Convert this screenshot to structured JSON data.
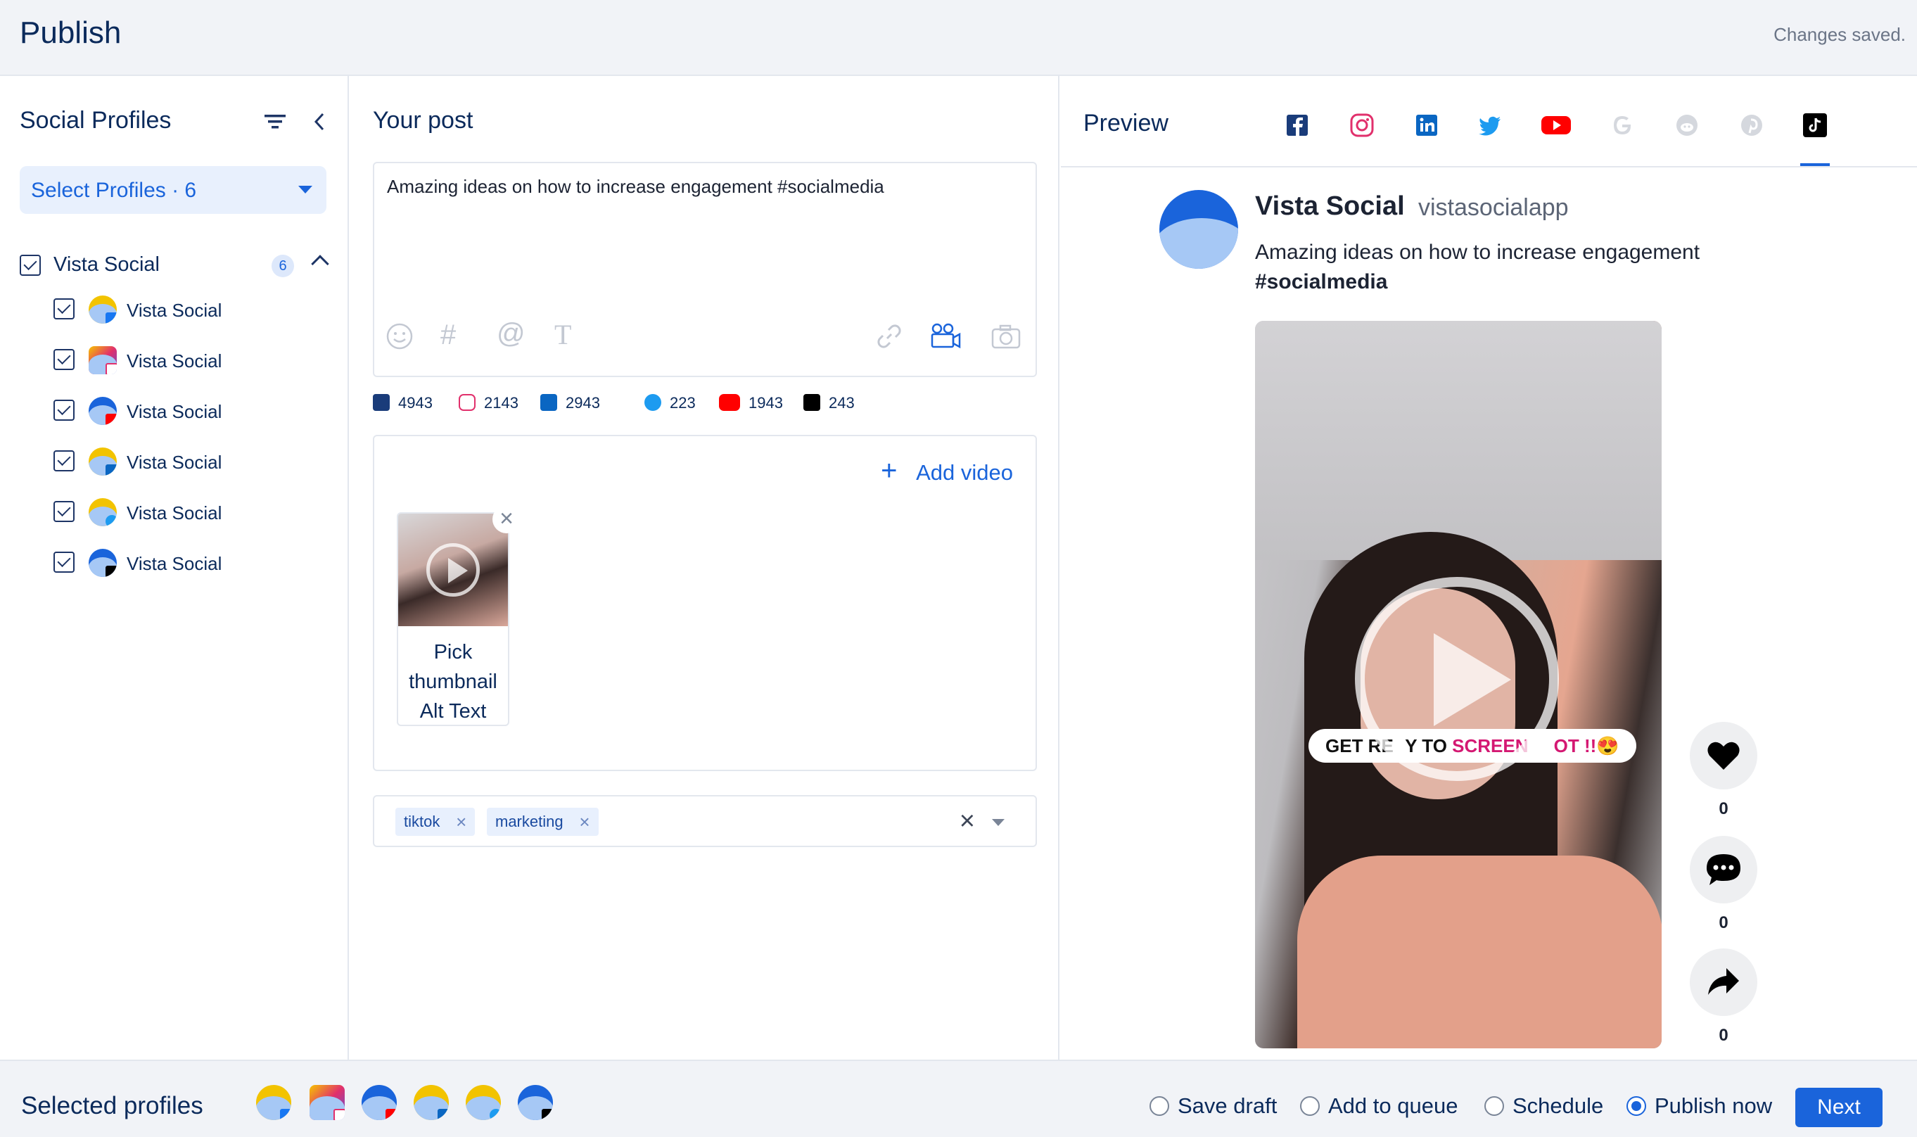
{
  "header": {
    "title": "Publish",
    "status": "Changes saved."
  },
  "profiles_panel": {
    "title": "Social Profiles",
    "select_label": "Select Profiles · 6",
    "group": {
      "name": "Vista Social",
      "count": "6"
    },
    "items": [
      {
        "name": "Vista Social",
        "network": "facebook"
      },
      {
        "name": "Vista Social",
        "network": "instagram"
      },
      {
        "name": "Vista Social",
        "network": "youtube"
      },
      {
        "name": "Vista Social",
        "network": "linkedin"
      },
      {
        "name": "Vista Social",
        "network": "twitter"
      },
      {
        "name": "Vista Social",
        "network": "tiktok"
      }
    ]
  },
  "post_panel": {
    "title": "Your post",
    "text": "Amazing ideas on how to increase engagement #socialmedia",
    "tools": {
      "hashtag": "#",
      "mention": "@",
      "text_format": "T"
    },
    "char_counts": [
      {
        "network": "facebook",
        "value": "4943",
        "color": "#1877f2"
      },
      {
        "network": "instagram",
        "value": "2143",
        "color": "#e1306c"
      },
      {
        "network": "linkedin",
        "value": "2943",
        "color": "#0a66c2"
      },
      {
        "network": "twitter",
        "value": "223",
        "color": "#1d9bf0"
      },
      {
        "network": "youtube",
        "value": "1943",
        "color": "#ff0000"
      },
      {
        "network": "tiktok",
        "value": "243",
        "color": "#000000"
      }
    ],
    "add_video_label": "Add video",
    "thumbnail": {
      "close": "×",
      "label_line1": "Pick",
      "label_line2": "thumbnail",
      "label_line3": "Alt Text"
    },
    "tags": [
      {
        "label": "tiktok"
      },
      {
        "label": "marketing"
      }
    ],
    "tag_remove": "×",
    "tags_clear": "×"
  },
  "preview_panel": {
    "title": "Preview",
    "networks": [
      "facebook",
      "instagram",
      "linkedin",
      "twitter",
      "youtube",
      "google",
      "reddit",
      "pinterest",
      "tiktok"
    ],
    "active_network": "tiktok",
    "profile_name": "Vista Social",
    "handle": "vistasocialapp",
    "text_line1": "Amazing ideas on how to increase engagement",
    "text_hashtag": "#socialmedia",
    "video_caption_a": "GET RE",
    "video_caption_b": "Y TO ",
    "video_caption_c": "SCREEN",
    "video_caption_d": "OT !!",
    "video_caption_emoji": "😍",
    "likes": "0",
    "comments": "0",
    "shares": "0"
  },
  "footer": {
    "label": "Selected profiles",
    "options": [
      {
        "label": "Save draft",
        "selected": false
      },
      {
        "label": "Add to queue",
        "selected": false
      },
      {
        "label": "Schedule",
        "selected": false
      },
      {
        "label": "Publish now",
        "selected": true
      }
    ],
    "next_label": "Next"
  },
  "colors": {
    "accent": "#1a64db",
    "text": "#0b2a5b",
    "border": "#e3e7ee"
  }
}
